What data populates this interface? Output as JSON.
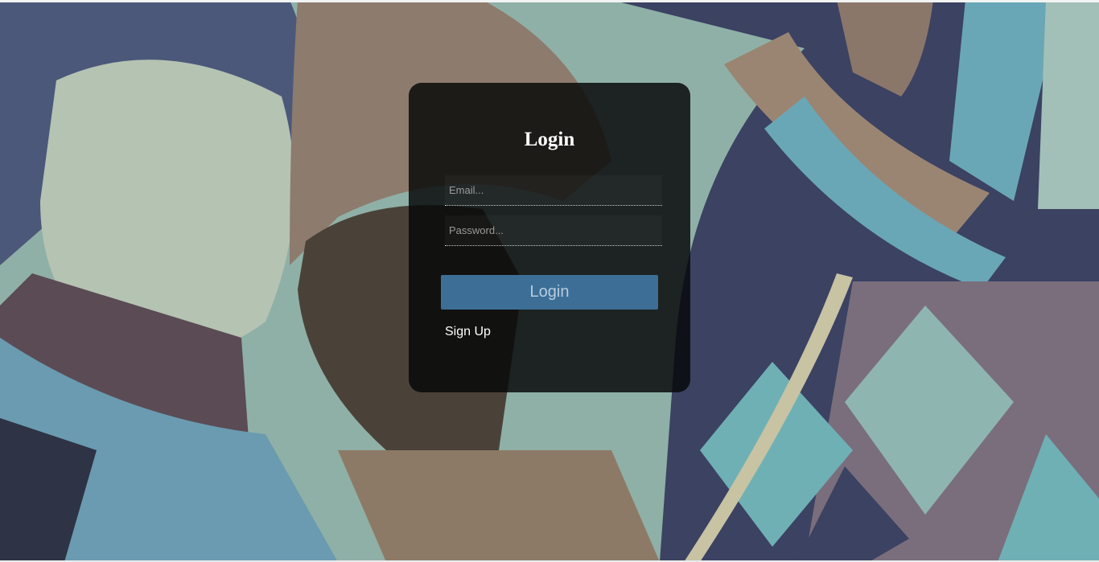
{
  "page": {
    "background_image_description_icon": "fashion-photo-icon"
  },
  "login": {
    "title": "Login",
    "email_placeholder": "Email...",
    "email_value": "",
    "password_placeholder": "Password...",
    "password_value": "",
    "submit_label": "Login",
    "signup_label": "Sign Up"
  },
  "colors": {
    "panel_bg": "#0a0c0c",
    "button_bg": "#3d6f96",
    "button_text": "#b6cce0",
    "background_tint": "#8fb0a6"
  }
}
